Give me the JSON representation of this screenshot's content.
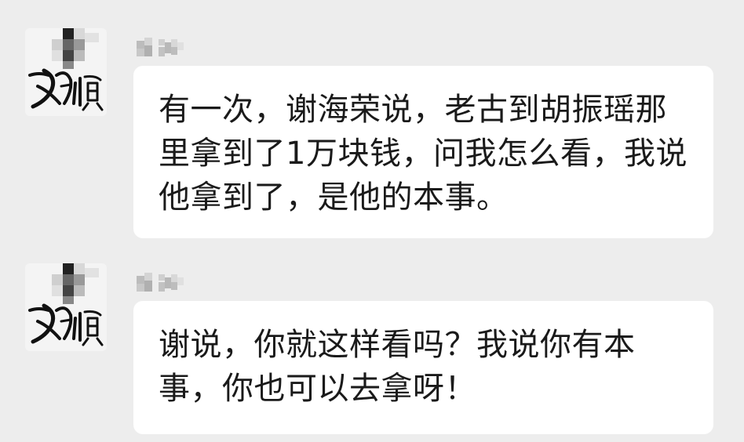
{
  "messages": [
    {
      "avatar_icon": "calligraphy-avatar-icon",
      "text": "有一次，谢海荣说，老古到胡振瑶那里拿到了1万块钱，问我怎么看，我说他拿到了，是他的本事。"
    },
    {
      "avatar_icon": "calligraphy-avatar-icon",
      "text": "谢说，你就这样看吗？我说你有本事，你也可以去拿呀！"
    }
  ],
  "colors": {
    "background": "#ededed",
    "bubble": "#ffffff",
    "text": "#1a1a1a"
  }
}
